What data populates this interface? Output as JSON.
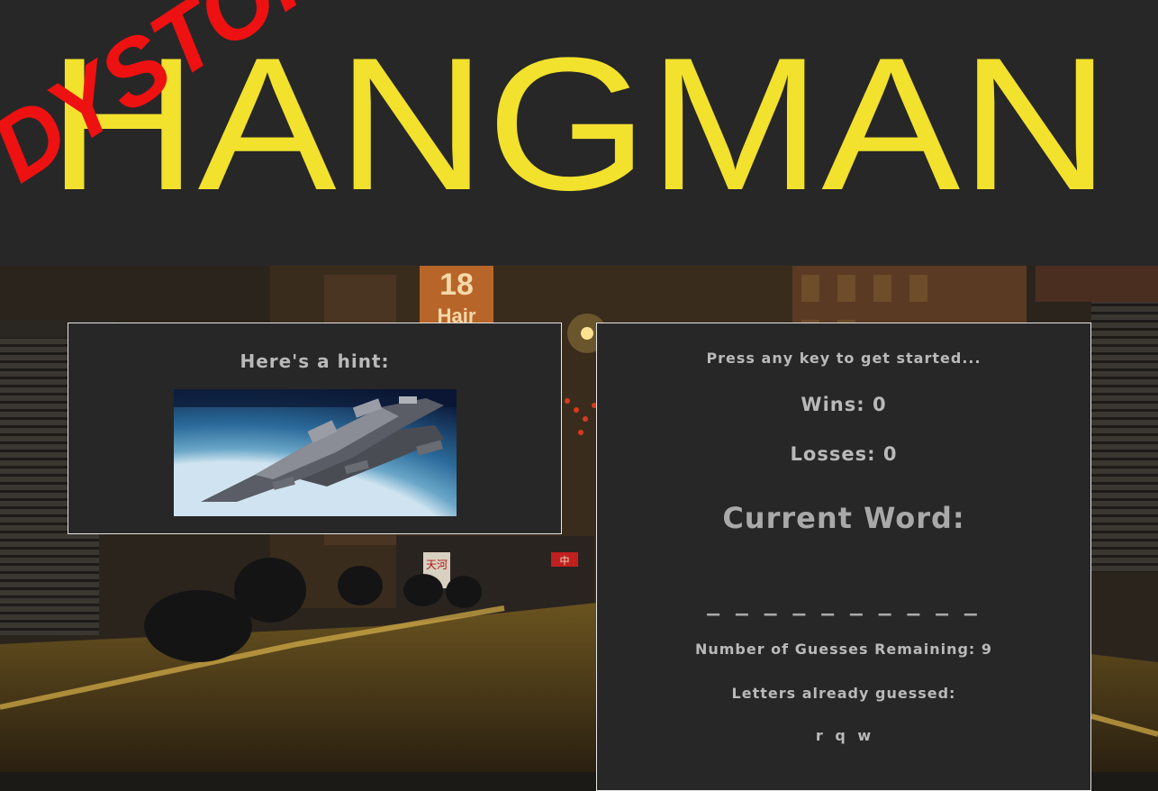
{
  "header": {
    "title": "HANGMAN",
    "overlay": "DYSTOPIA",
    "title_color": "#f2e12d",
    "overlay_color": "#ee1111",
    "background": "#272727"
  },
  "scene": {
    "shop_sign_number": "18",
    "shop_sign_word": "Hair",
    "signs": [
      "天河",
      "中"
    ]
  },
  "hint": {
    "label": "Here's a hint:"
  },
  "game": {
    "prompt": "Press any key to get started...",
    "wins_label": "Wins:",
    "wins": "0",
    "losses_label": "Losses:",
    "losses": "0",
    "current_word_label": "Current Word:",
    "current_word": "_ _ _ _ _ _ _ _ _ _",
    "guesses_label": "Number of Guesses Remaining:",
    "guesses": "9",
    "letters_label": "Letters already guessed:",
    "letters": "r q w"
  }
}
